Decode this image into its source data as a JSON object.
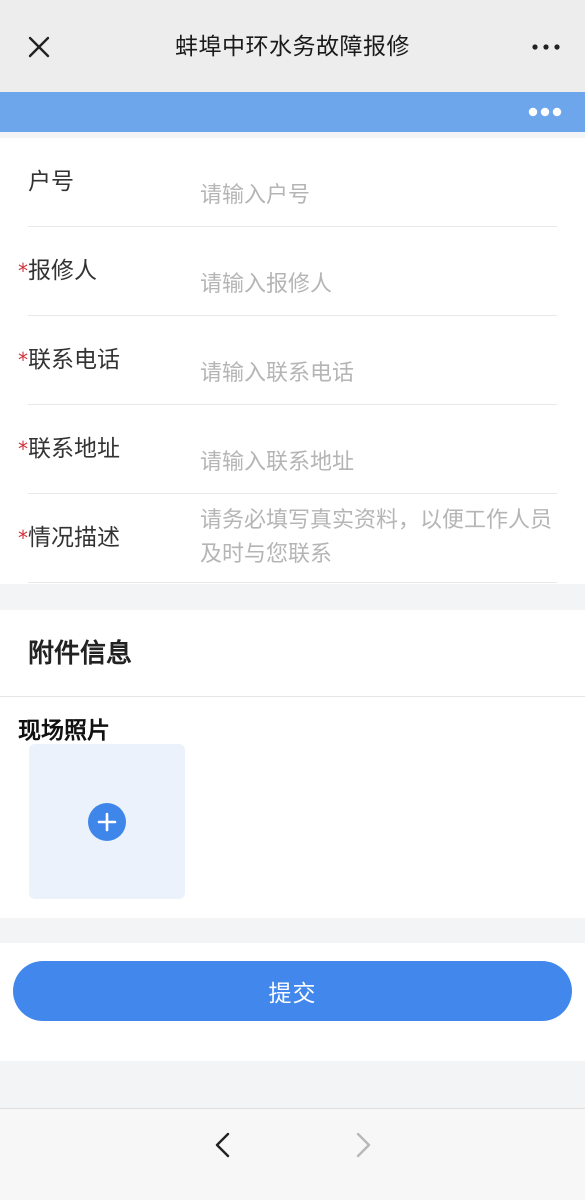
{
  "navbar": {
    "title": "蚌埠中环水务故障报修",
    "close_icon": "close-icon",
    "more_icon": "more-horizontal-icon"
  },
  "banner": {
    "color": "#6ea6ec",
    "more_icon": "more-dots-icon"
  },
  "form": {
    "required_mark": "*",
    "fields": [
      {
        "label": "户号",
        "placeholder": "请输入户号",
        "required": false
      },
      {
        "label": "报修人",
        "placeholder": "请输入报修人",
        "required": true
      },
      {
        "label": "联系电话",
        "placeholder": "请输入联系电话",
        "required": true
      },
      {
        "label": "联系地址",
        "placeholder": "请输入联系地址",
        "required": true
      },
      {
        "label": "情况描述",
        "placeholder": "请务必填写真实资料，以便工作人员及时与您联系",
        "required": true
      }
    ]
  },
  "attachments": {
    "title": "附件信息",
    "photo_label": "现场照片",
    "upload_icon": "plus-icon"
  },
  "submit": {
    "label": "提交",
    "color": "#4288ec"
  },
  "bottom_nav": {
    "back_icon": "chevron-left-icon",
    "forward_icon": "chevron-right-icon"
  }
}
